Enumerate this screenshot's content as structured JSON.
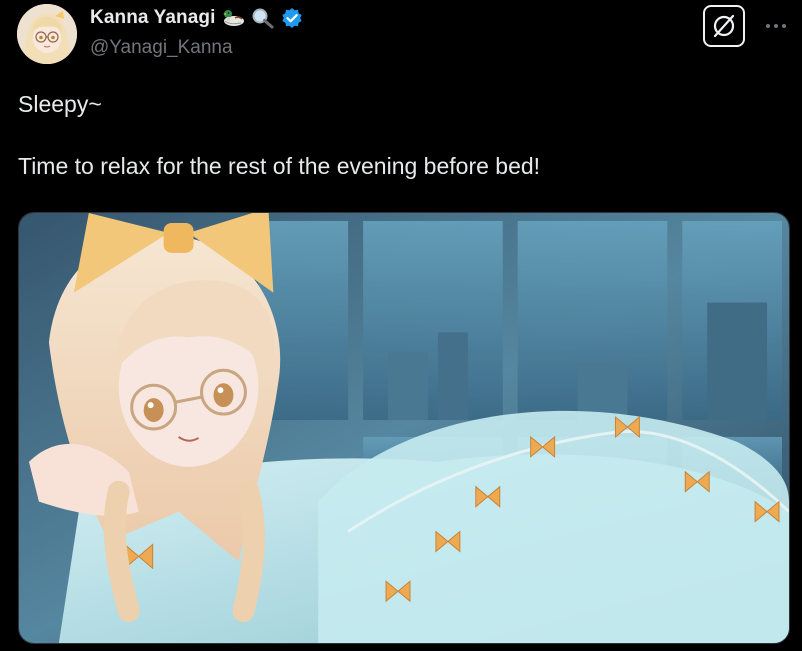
{
  "tweet": {
    "author": {
      "display_name": "Kanna Yanagi",
      "handle": "@Yanagi_Kanna",
      "name_emojis": [
        "duck-icon",
        "magnifier-icon"
      ],
      "verified": true,
      "verified_color": "#1d9bf0"
    },
    "text_lines": [
      "Sleepy~",
      "Time to relax for the rest of the evening before bed!"
    ],
    "media": {
      "alt_icon": "anime-illustration-image"
    },
    "actions": {
      "grok_icon": "grok-icon",
      "more_icon": "more-horizontal-icon"
    }
  },
  "colors": {
    "background": "#000000",
    "text_primary": "#e7e9ea",
    "text_secondary": "#71767b"
  }
}
